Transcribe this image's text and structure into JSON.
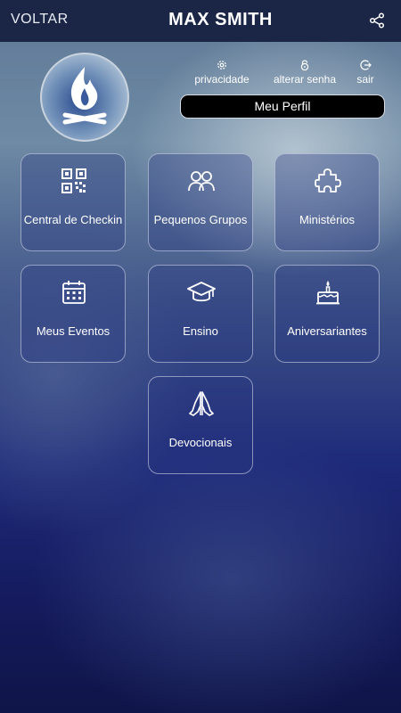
{
  "header": {
    "back_label": "VOLTAR",
    "title": "MAX SMITH",
    "share_icon": "share-icon"
  },
  "actions": {
    "privacy": {
      "label": "privacidade",
      "icon": "gear-icon"
    },
    "password": {
      "label": "alterar senha",
      "icon": "lock-icon"
    },
    "exit": {
      "label": "sair",
      "icon": "logout-icon"
    }
  },
  "profile_button": {
    "label": "Meu Perfil"
  },
  "menu": [
    {
      "label": "Central de Checkin",
      "icon": "qr-code-icon"
    },
    {
      "label": "Pequenos Grupos",
      "icon": "group-icon"
    },
    {
      "label": "Ministérios",
      "icon": "puzzle-icon"
    },
    {
      "label": "Meus Eventos",
      "icon": "calendar-icon"
    },
    {
      "label": "Ensino",
      "icon": "graduation-cap-icon"
    },
    {
      "label": "Aniversariantes",
      "icon": "birthday-cake-icon"
    },
    {
      "label": "Devocionais",
      "icon": "praying-hands-icon"
    }
  ],
  "colors": {
    "header_bg": "#1b2546",
    "button_bg": "#000000",
    "tile_border": "#dce1f0"
  }
}
